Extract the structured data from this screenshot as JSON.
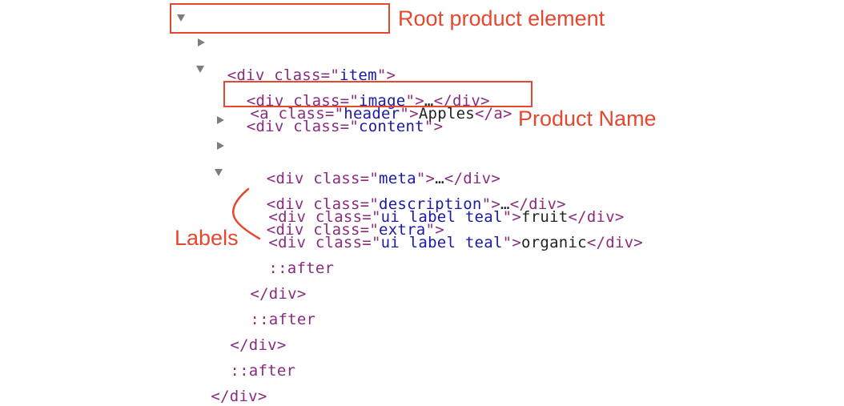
{
  "tree": {
    "root_open": "<div class=\"item\">",
    "image_open": "<div class=\"image\">",
    "image_ellipsis": "…",
    "image_close": "</div>",
    "content_open": "<div class=\"content\">",
    "header_open": "<a class=\"header\">",
    "header_text": "Apples",
    "header_close": "</a>",
    "meta_open": "<div class=\"meta\">",
    "meta_ellipsis": "…",
    "meta_close": "</div>",
    "description_open": "<div class=\"description\">",
    "description_ellipsis": "…",
    "description_close": "</div>",
    "extra_open": "<div class=\"extra\">",
    "label1_open": "<div class=\"ui label teal\">",
    "label1_text": "fruit",
    "label1_close": "</div>",
    "label2_open": "<div class=\"ui label teal\">",
    "label2_text": "organic",
    "label2_close": "</div>",
    "after_extra": "::after",
    "extra_close": "</div>",
    "after_content": "::after",
    "content_close": "</div>",
    "after_root": "::after",
    "root_close": "</div>"
  },
  "annotations": {
    "root": "Root product element",
    "product_name": "Product Name",
    "labels": "Labels"
  },
  "colors": {
    "annotation": "#e5482f",
    "tag": "#8a2c7e",
    "attr_value": "#1a1aa6",
    "text": "#222222"
  }
}
